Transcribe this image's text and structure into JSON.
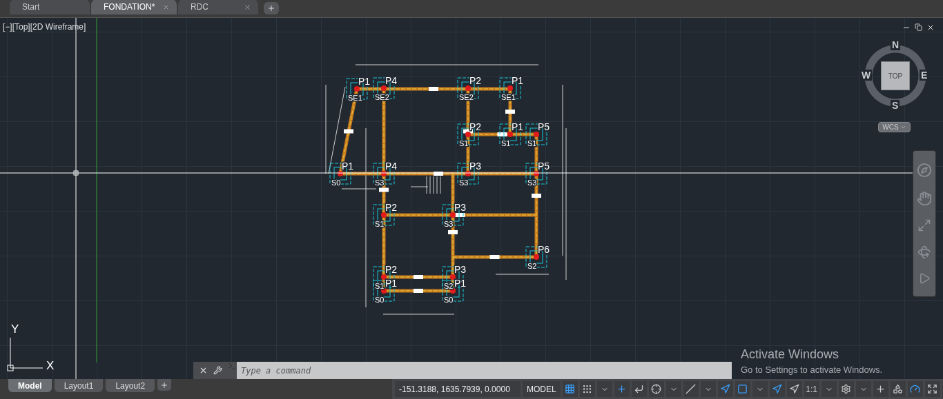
{
  "file_tabs": [
    {
      "label": "Start",
      "selected": false,
      "closable": false
    },
    {
      "label": "FONDATION*",
      "selected": true,
      "closable": true
    },
    {
      "label": "RDC",
      "selected": false,
      "closable": true
    }
  ],
  "viewport": {
    "label": "[−][Top][2D Wireframe]"
  },
  "viewcube": {
    "north": "N",
    "east": "E",
    "south": "S",
    "west": "W",
    "face": "TOP",
    "ucs": "WCS"
  },
  "footings": [
    {
      "column": "P1",
      "base": "SE1"
    },
    {
      "column": "P4",
      "base": "SE2"
    },
    {
      "column": "P2",
      "base": "SE2"
    },
    {
      "column": "P1",
      "base": "SE1"
    },
    {
      "column": "P2",
      "base": "S1"
    },
    {
      "column": "P1",
      "base": "S1"
    },
    {
      "column": "P5",
      "base": "S1"
    },
    {
      "column": "P1",
      "base": "S0"
    },
    {
      "column": "P4",
      "base": "S3"
    },
    {
      "column": "P3",
      "base": "S3"
    },
    {
      "column": "P5",
      "base": "S3"
    },
    {
      "column": "P2",
      "base": "S1"
    },
    {
      "column": "P3",
      "base": "S3"
    },
    {
      "column": "P6",
      "base": "S2"
    },
    {
      "column": "P2",
      "base": "S1"
    },
    {
      "column": "P3",
      "base": "S2"
    },
    {
      "column": "P1",
      "base": "S0"
    },
    {
      "column": "P1",
      "base": "S0"
    }
  ],
  "ucs_icon": {
    "x": "X",
    "y": "Y"
  },
  "command_line": {
    "placeholder": "Type a command"
  },
  "layout_tabs": [
    {
      "label": "Model",
      "selected": true
    },
    {
      "label": "Layout1",
      "selected": false
    },
    {
      "label": "Layout2",
      "selected": false
    }
  ],
  "status_bar": {
    "coordinates": "-151.3188, 1635.7939, 0.0000",
    "space": "MODEL",
    "scale": "1:1"
  },
  "activation_notice": {
    "title": "Activate Windows",
    "message": "Go to Settings to activate Windows."
  }
}
